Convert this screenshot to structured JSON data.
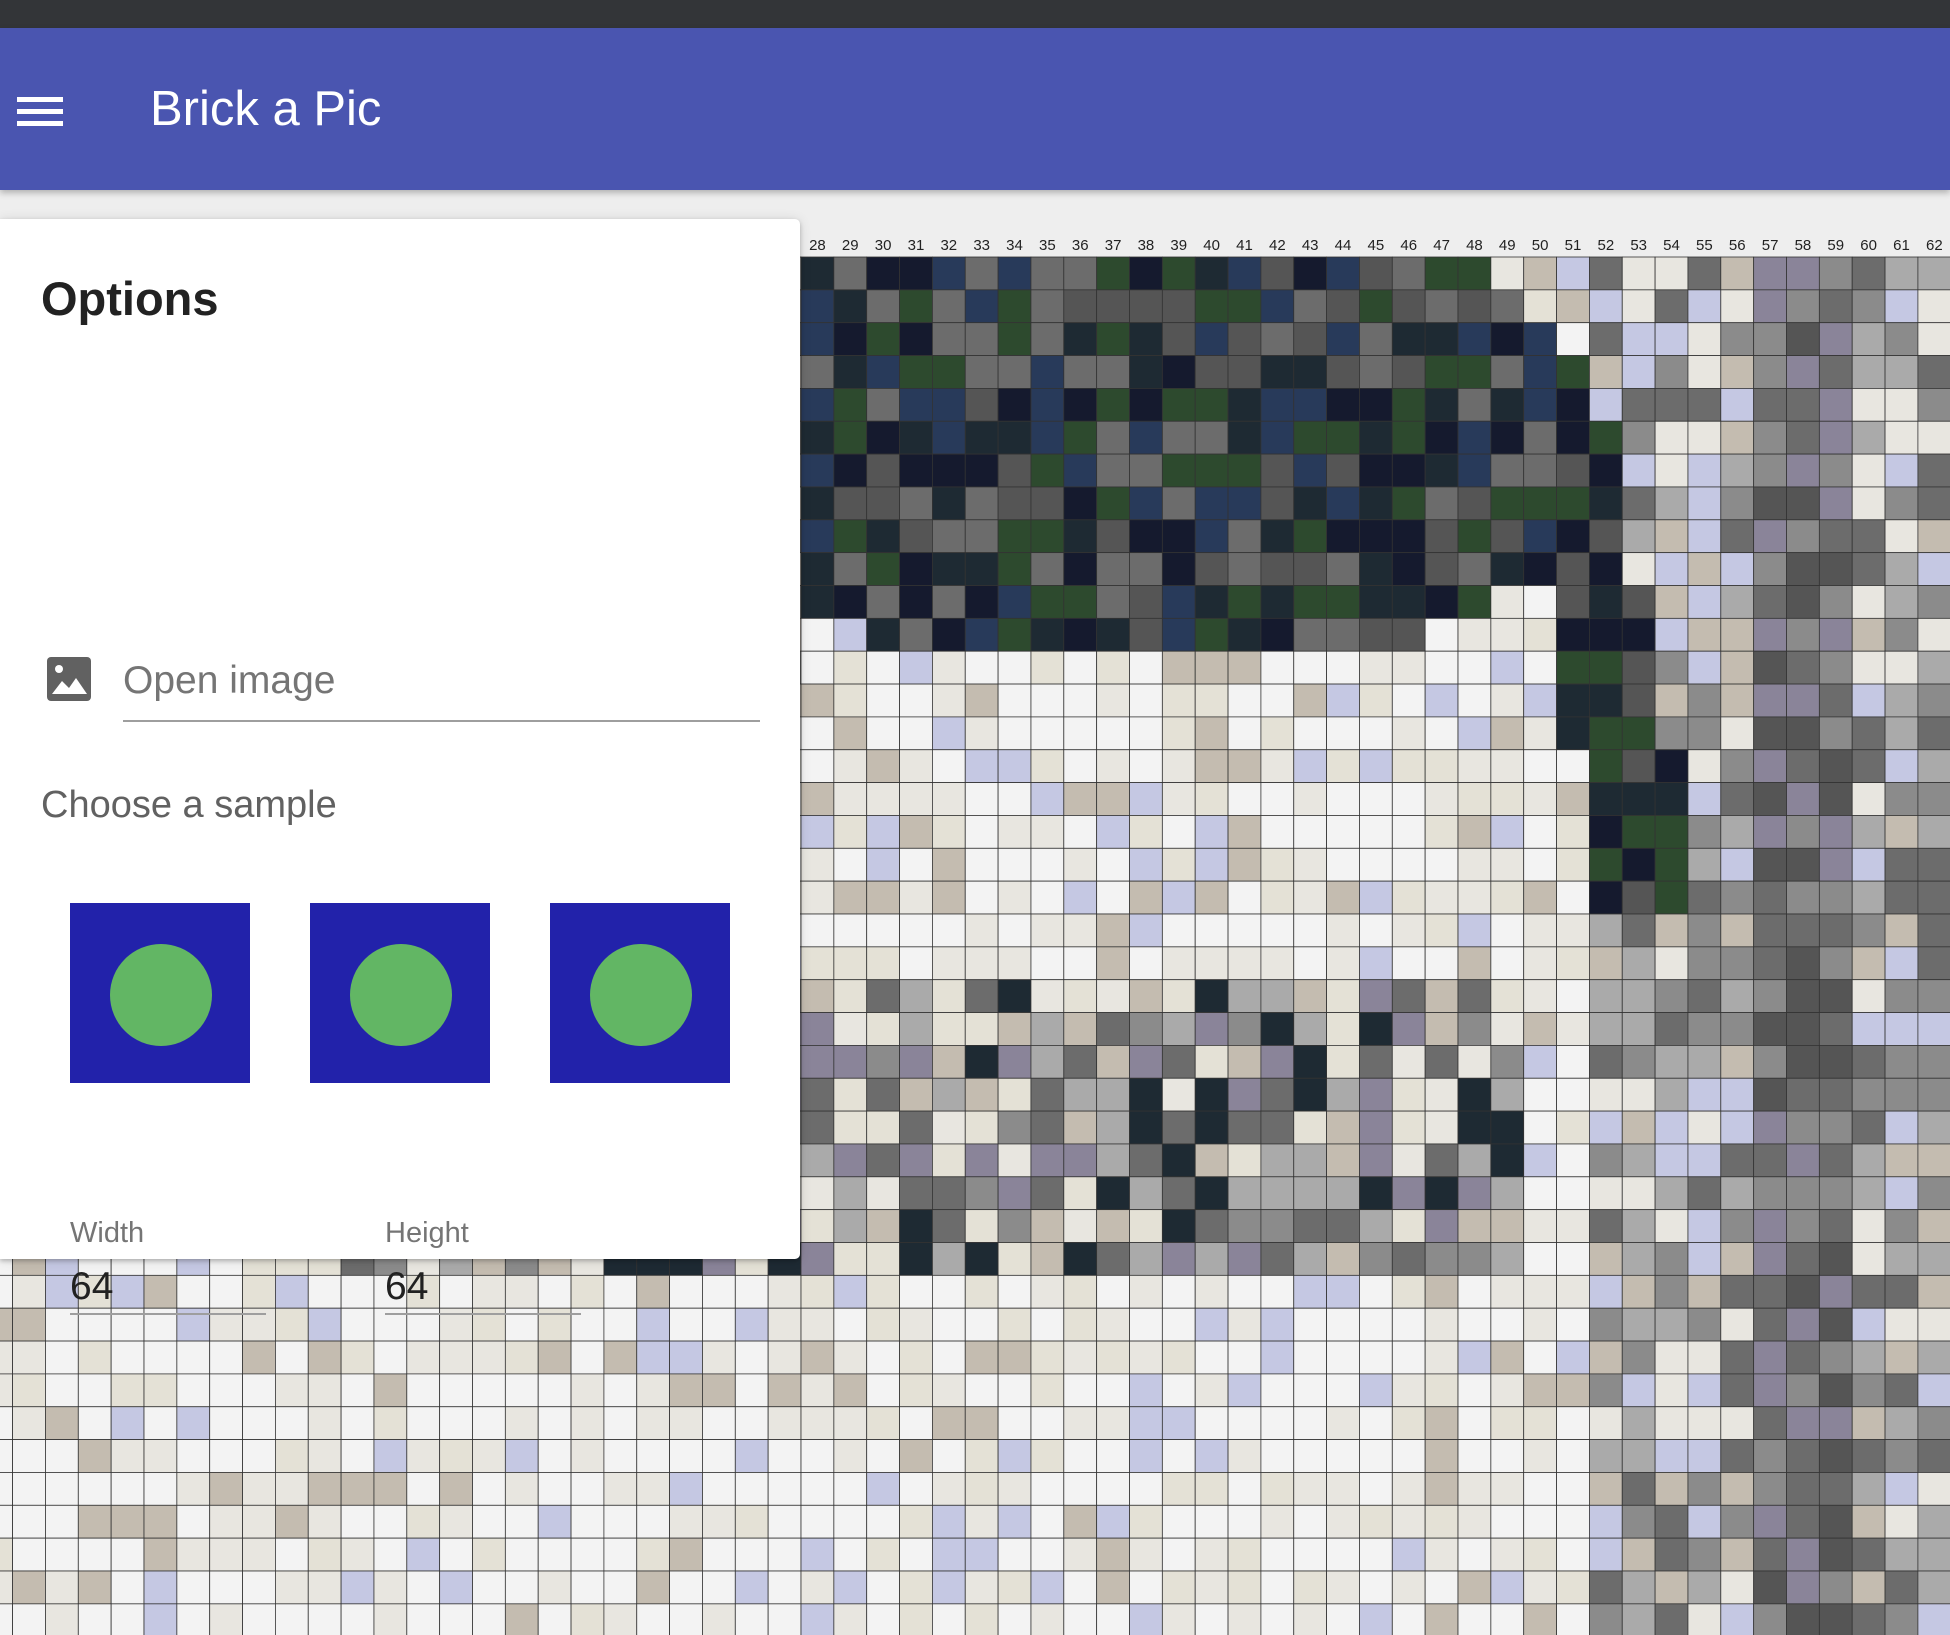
{
  "app": {
    "title": "Brick a Pic",
    "colors": {
      "app_bar": "#4a55b0",
      "sample_background": "#2222aa",
      "sample_circle": "#62b664"
    }
  },
  "options_panel": {
    "title": "Options",
    "open_image_label": "Open image",
    "sample_heading": "Choose a sample",
    "samples": [
      "sample-1",
      "sample-2",
      "sample-3"
    ],
    "width": {
      "label": "Width",
      "value": "64"
    },
    "height": {
      "label": "Height",
      "value": "64"
    }
  },
  "mosaic": {
    "visible_columns": [
      "28",
      "29",
      "30",
      "31",
      "32",
      "33",
      "34",
      "35",
      "36",
      "37",
      "38",
      "39",
      "40",
      "41",
      "42",
      "43",
      "44",
      "45",
      "46",
      "47",
      "48",
      "49",
      "50",
      "51",
      "52",
      "53",
      "54",
      "55",
      "56",
      "57",
      "58",
      "59",
      "60",
      "61",
      "62"
    ],
    "palette": [
      "#f3f3f3",
      "#e8e6e0",
      "#e4e1d6",
      "#c4bcb0",
      "#aaaaaa",
      "#8b8b8b",
      "#6c6c6c",
      "#555555",
      "#1e2a33",
      "#2d4a2e",
      "#283a5a",
      "#c5c8e3",
      "#8a8499",
      "#151a2e"
    ]
  }
}
